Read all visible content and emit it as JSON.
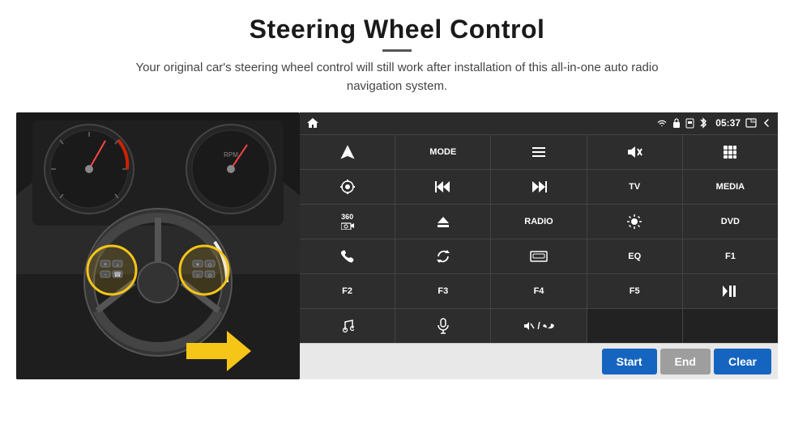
{
  "header": {
    "title": "Steering Wheel Control",
    "description": "Your original car's steering wheel control will still work after installation of this all-in-one auto radio navigation system."
  },
  "status_bar": {
    "time": "05:37",
    "icons": [
      "wifi",
      "lock",
      "sim",
      "bluetooth",
      "back",
      "home"
    ]
  },
  "button_grid": [
    [
      {
        "label": "",
        "icon": "navigate",
        "type": "icon"
      },
      {
        "label": "MODE",
        "icon": "",
        "type": "text"
      },
      {
        "label": "",
        "icon": "menu",
        "type": "icon"
      },
      {
        "label": "",
        "icon": "mute",
        "type": "icon"
      },
      {
        "label": "",
        "icon": "apps",
        "type": "icon"
      }
    ],
    [
      {
        "label": "",
        "icon": "settings-circle",
        "type": "icon"
      },
      {
        "label": "",
        "icon": "prev",
        "type": "icon"
      },
      {
        "label": "",
        "icon": "next",
        "type": "icon"
      },
      {
        "label": "TV",
        "icon": "",
        "type": "text"
      },
      {
        "label": "MEDIA",
        "icon": "",
        "type": "text"
      }
    ],
    [
      {
        "label": "360",
        "icon": "360cam",
        "type": "icon-text"
      },
      {
        "label": "",
        "icon": "eject",
        "type": "icon"
      },
      {
        "label": "RADIO",
        "icon": "",
        "type": "text"
      },
      {
        "label": "",
        "icon": "brightness",
        "type": "icon"
      },
      {
        "label": "DVD",
        "icon": "",
        "type": "text"
      }
    ],
    [
      {
        "label": "",
        "icon": "phone",
        "type": "icon"
      },
      {
        "label": "",
        "icon": "sync",
        "type": "icon"
      },
      {
        "label": "",
        "icon": "window",
        "type": "icon"
      },
      {
        "label": "EQ",
        "icon": "",
        "type": "text"
      },
      {
        "label": "F1",
        "icon": "",
        "type": "text"
      }
    ],
    [
      {
        "label": "F2",
        "icon": "",
        "type": "text"
      },
      {
        "label": "F3",
        "icon": "",
        "type": "text"
      },
      {
        "label": "F4",
        "icon": "",
        "type": "text"
      },
      {
        "label": "F5",
        "icon": "",
        "type": "text"
      },
      {
        "label": "",
        "icon": "play-pause",
        "type": "icon"
      }
    ],
    [
      {
        "label": "",
        "icon": "music",
        "type": "icon"
      },
      {
        "label": "",
        "icon": "mic",
        "type": "icon"
      },
      {
        "label": "",
        "icon": "vol-phone",
        "type": "icon"
      },
      {
        "label": "",
        "icon": "",
        "type": "empty"
      },
      {
        "label": "",
        "icon": "",
        "type": "empty"
      }
    ]
  ],
  "bottom_buttons": {
    "start": "Start",
    "end": "End",
    "clear": "Clear"
  }
}
